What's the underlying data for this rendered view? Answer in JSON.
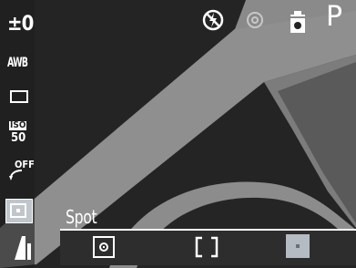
{
  "screen": {
    "left_indicators": {
      "exposure_comp": "±0",
      "white_balance": "AWB",
      "iso_label": "ISO",
      "iso_value": "50",
      "self_timer": "OFF"
    },
    "top_indicators": {
      "shooting_mode": "P"
    },
    "metering": {
      "selected_label": "Spot",
      "options": [
        "evaluative",
        "center-weighted",
        "spot"
      ],
      "selected_index": 2
    }
  },
  "colors": {
    "scene_dark": "#242424",
    "scene_light": "#8e8e8e",
    "highlight": "#b5bbc2",
    "text": "#ffffff"
  }
}
